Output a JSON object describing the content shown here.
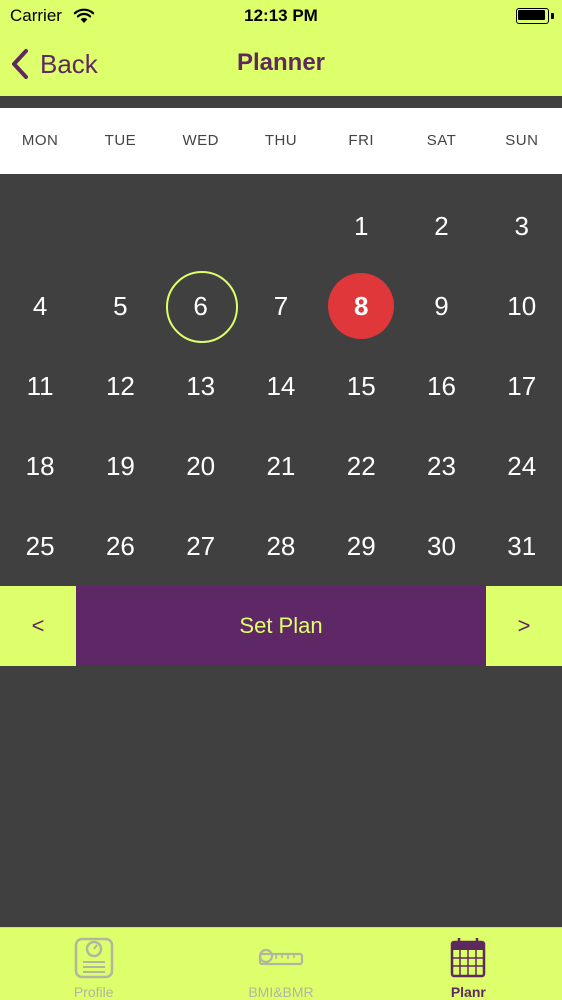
{
  "status_bar": {
    "carrier": "Carrier",
    "time": "12:13 PM"
  },
  "nav": {
    "back_label": "Back",
    "title": "Planner"
  },
  "calendar": {
    "weekdays": [
      "MON",
      "TUE",
      "WED",
      "THU",
      "FRI",
      "SAT",
      "SUN"
    ],
    "weeks": [
      [
        "",
        "",
        "",
        "",
        "1",
        "2",
        "3"
      ],
      [
        "4",
        "5",
        "6",
        "7",
        "8",
        "9",
        "10"
      ],
      [
        "11",
        "12",
        "13",
        "14",
        "15",
        "16",
        "17"
      ],
      [
        "18",
        "19",
        "20",
        "21",
        "22",
        "23",
        "24"
      ],
      [
        "25",
        "26",
        "27",
        "28",
        "29",
        "30",
        "31"
      ]
    ],
    "selected_day": "6",
    "today": "8"
  },
  "plan": {
    "prev_label": "<",
    "set_label": "Set Plan",
    "next_label": ">"
  },
  "tabs": [
    {
      "label": "Profile",
      "icon": "scale-icon",
      "active": false
    },
    {
      "label": "BMI&BMR",
      "icon": "tape-measure-icon",
      "active": false
    },
    {
      "label": "Planr",
      "icon": "calendar-icon",
      "active": true
    }
  ],
  "colors": {
    "accent": "#DDFF6B",
    "brand": "#5E2766",
    "today": "#E0383A",
    "background": "#404040"
  }
}
